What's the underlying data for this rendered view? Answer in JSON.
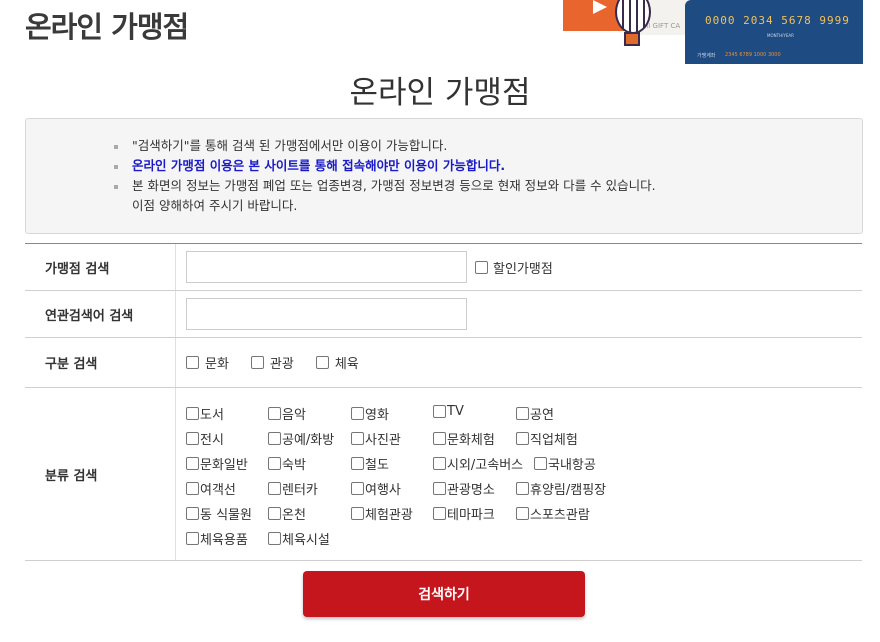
{
  "header": {
    "title": "온라인 가맹점"
  },
  "banner": {
    "ticket_text": "HI GIFT CA",
    "card_number": "0000 2034 5678 9999",
    "card_small": "MONTH/YEAR",
    "card_foot": "가맹계좌",
    "card_foot2": "2345 6789 1000 3000",
    "colors": {
      "ticket": "#e8652e",
      "card": "#1e4b82",
      "card_number": "#f2c15a"
    }
  },
  "page": {
    "title": "온라인 가맹점"
  },
  "notice": {
    "items": [
      {
        "text": "\"검색하기\"를 통해 검색 된 가맹점에서만 이용이 가능합니다.",
        "style": "normal"
      },
      {
        "text": "온라인 가맹점 이용은 본 사이트를 통해 접속해야만 이용이 가능합니다.",
        "style": "blue"
      },
      {
        "text": "본 화면의 정보는 가맹점 폐업 또는 업종변경, 가맹점 정보변경 등으로 현재 정보와 다를 수 있습니다.",
        "style": "normal"
      },
      {
        "text": "이점 양해하여 주시기 바랍니다.",
        "style": "cont"
      }
    ]
  },
  "form": {
    "store_search": {
      "label": "가맹점 검색",
      "value": "",
      "discount_label": "할인가맹점"
    },
    "related_search": {
      "label": "연관검색어 검색",
      "value": ""
    },
    "type_search": {
      "label": "구분 검색",
      "options": [
        "문화",
        "관광",
        "체육"
      ]
    },
    "category_search": {
      "label": "분류 검색",
      "rows": [
        [
          "도서",
          "음악",
          "영화",
          "TV",
          "공연"
        ],
        [
          "전시",
          "공예/화방",
          "사진관",
          "문화체험",
          "직업체험"
        ],
        [
          "문화일반",
          "숙박",
          "철도",
          "시외/고속버스",
          "국내항공"
        ],
        [
          "여객선",
          "렌터카",
          "여행사",
          "관광명소",
          "휴양림/캠핑장"
        ],
        [
          "동 식물원",
          "온천",
          "체험관광",
          "테마파크",
          "스포츠관람"
        ],
        [
          "체육용품",
          "체육시설"
        ]
      ]
    }
  },
  "search_button": {
    "label": "검색하기",
    "color": "#c4161c"
  }
}
